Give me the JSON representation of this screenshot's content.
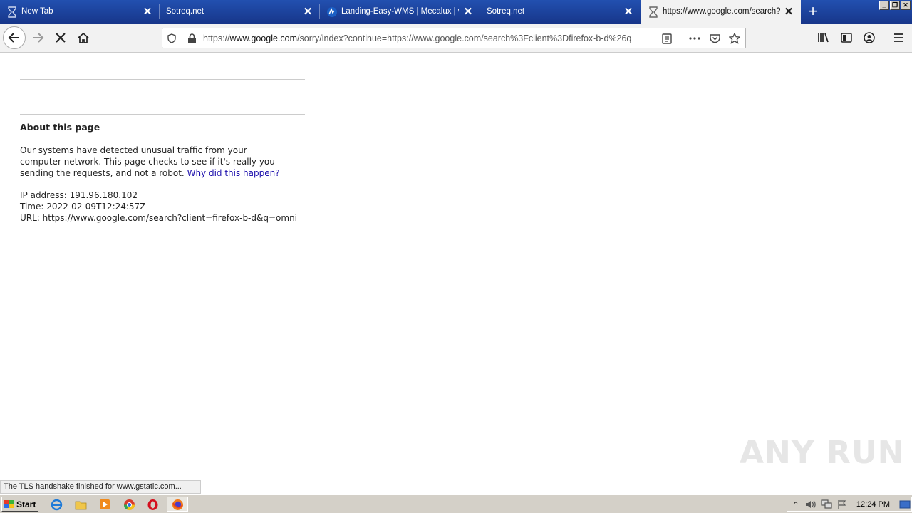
{
  "tabs": [
    {
      "label": "New Tab",
      "favicon": "hourglass-icon"
    },
    {
      "label": "Sotreq.net",
      "favicon": ""
    },
    {
      "label": "Landing-Easy-WMS | Mecalux | w",
      "favicon": "mecalux-icon"
    },
    {
      "label": "Sotreq.net",
      "favicon": ""
    },
    {
      "label": "https://www.google.com/search?c",
      "favicon": "hourglass-icon",
      "active": true
    }
  ],
  "url": {
    "prefix": "https://",
    "host": "www.google.com",
    "rest": "/sorry/index?continue=https://www.google.com/search%3Fclient%3Dfirefox-b-d%26q"
  },
  "page": {
    "about_title": "About this page",
    "body_text": "Our systems have detected unusual traffic from your computer network. This page checks to see if it's really you sending the requests, and not a robot.",
    "why_link": "Why did this happen?",
    "ip_line": "IP address: 191.96.180.102",
    "time_line": "Time: 2022-02-09T12:24:57Z",
    "url_line": "URL: https://www.google.com/search?client=firefox-b-d&q=omni"
  },
  "status_text": "The TLS handshake finished for www.gstatic.com...",
  "taskbar": {
    "start_label": "Start",
    "clock": "12:24 PM"
  },
  "watermark": "ANY RUN",
  "colors": {
    "tabstrip": "#1f4aa6",
    "link": "#1a0dab"
  }
}
